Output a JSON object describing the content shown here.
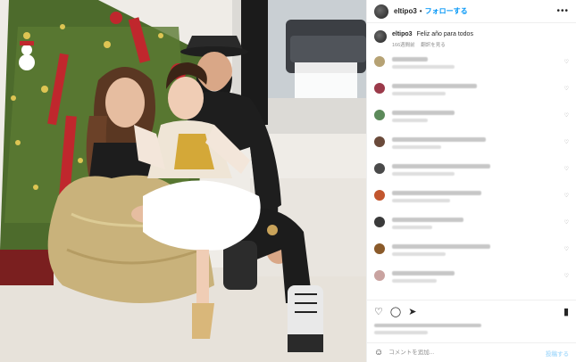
{
  "post": {
    "username": "eltipo3",
    "separator": "•",
    "follow_label": "フォローする",
    "more_icon": "more-horizontal-icon",
    "caption_username": "eltipo3",
    "caption_text": "Feliz año para todos",
    "time_ago": "166週間前",
    "translate_label": "翻訳を見る"
  },
  "comments": [
    {
      "avatar_color": "#b6a274"
    },
    {
      "avatar_color": "#9b3a4a"
    },
    {
      "avatar_color": "#5c8a5a"
    },
    {
      "avatar_color": "#6a4a3a"
    },
    {
      "avatar_color": "#4a4a4a"
    },
    {
      "avatar_color": "#c2562e"
    },
    {
      "avatar_color": "#3a3a3a"
    },
    {
      "avatar_color": "#8a5a2a"
    },
    {
      "avatar_color": "#c9a3a0"
    }
  ],
  "actions": {
    "like_icon": "heart-icon",
    "comment_icon": "comment-icon",
    "share_icon": "send-icon",
    "save_icon": "bookmark-icon"
  },
  "add_comment": {
    "emoji_icon": "emoji-icon",
    "placeholder": "コメントを追加...",
    "post_label": "投稿する"
  },
  "colors": {
    "link_blue": "#0095f6",
    "disabled_blue": "#b2dffc",
    "border": "#efefef",
    "muted": "#8e8e8e"
  }
}
